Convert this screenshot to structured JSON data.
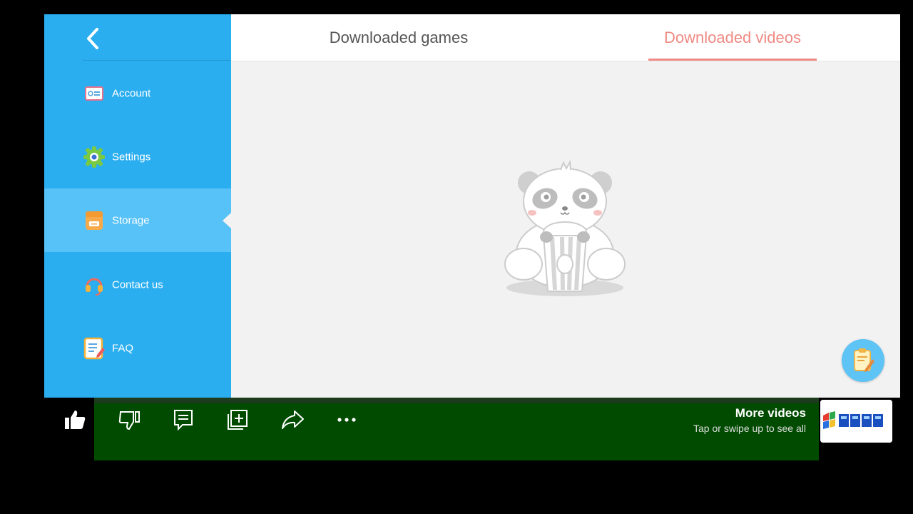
{
  "sidebar": {
    "back_icon": "chevron-left-icon",
    "items": [
      {
        "label": "Account",
        "icon": "id-card-icon"
      },
      {
        "label": "Settings",
        "icon": "gear-icon"
      },
      {
        "label": "Storage",
        "icon": "storage-box-icon",
        "active": true
      },
      {
        "label": "Contact us",
        "icon": "headset-icon"
      },
      {
        "label": "FAQ",
        "icon": "faq-document-icon"
      }
    ]
  },
  "tabs": {
    "games_label": "Downloaded games",
    "videos_label": "Downloaded videos",
    "active": "videos"
  },
  "empty_state": {
    "illustration": "panda-popcorn-illustration"
  },
  "fab": {
    "icon": "feedback-notepad-icon"
  },
  "video_bar": {
    "actions": [
      "thumbs-up-icon",
      "thumbs-down-icon",
      "comment-icon",
      "add-to-playlist-icon",
      "share-icon",
      "more-icon"
    ],
    "more_videos_title": "More videos",
    "more_videos_subtitle": "Tap or swipe up to see all"
  },
  "colors": {
    "sidebar": "#2aaef0",
    "sidebar_active": "#57c2f7",
    "tab_active": "#ef8a84",
    "overlay_bar": "#004b00"
  }
}
